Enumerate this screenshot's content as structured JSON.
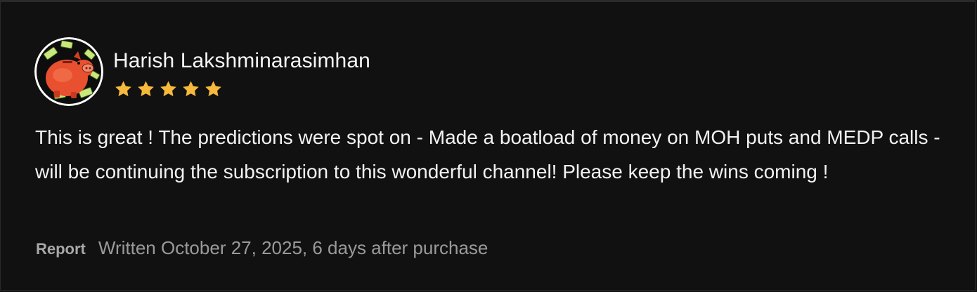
{
  "review": {
    "author_name": "Harish Lakshminarasimhan",
    "avatar_icon": "piggy-bank-with-money-icon",
    "rating": 5,
    "rating_max": 5,
    "star_color": "#f6b93b",
    "text": "This is great ! The predictions were spot on - Made a boatload of money on MOH puts and MEDP calls - will be continuing the subscription to this wonderful channel! Please keep the wins coming !",
    "report_label": "Report",
    "written_label": "Written October 27, 2025, 6 days after purchase"
  }
}
